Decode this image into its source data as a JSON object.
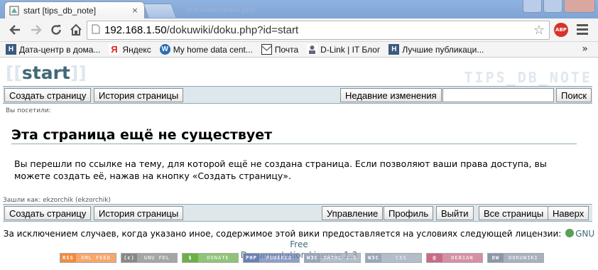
{
  "browser": {
    "tab_title": "start [tips_db_note]",
    "tab_close": "×",
    "ghost_tab_title": "dokuwiki/doku.php",
    "url_host": "192.168.1.50",
    "url_path": "/dokuwiki/doku.php?id=start",
    "abp_label": "ABP",
    "bookmarks": [
      {
        "label": "Дата-центр в дома...",
        "icon": "habr-icon"
      },
      {
        "label": "Яндекс",
        "icon": "yandex-icon"
      },
      {
        "label": "My home data cent...",
        "icon": "wordpress-icon"
      },
      {
        "label": "Почта",
        "icon": "mail-icon"
      },
      {
        "label": "D-Link | IT Блог",
        "icon": "dlink-icon"
      },
      {
        "label": "Лучшие публикаци...",
        "icon": "habr-icon"
      }
    ],
    "bookmarks_more": "»"
  },
  "wiki": {
    "page_name": "start",
    "page_name_open": "[[",
    "page_name_close": "]]",
    "wiki_title": "TIPS_DB_NOTE",
    "top_bar": {
      "create_page": "Создать страницу",
      "page_history": "История страницы",
      "recent_changes": "Недавние изменения",
      "search_value": "",
      "search_button": "Поиск"
    },
    "breadcrumbs": "Вы посетили:",
    "heading": "Эта страница ещё не существует",
    "body_line1": "Вы перешли по ссылке на тему, для которой ещё не создана страница. Если позволяют ваши права доступа, вы",
    "body_line2": "можете создать её, нажав на кнопку «Создать страницу».",
    "logged_in": "Зашли как: ekzorchik (ekzorchik)",
    "bottom_bar": {
      "create_page": "Создать страницу",
      "page_history": "История страницы",
      "admin": "Управление",
      "profile": "Профиль",
      "logout": "Выйти",
      "all_pages": "Все страницы",
      "top": "Наверх"
    },
    "license_text": "За исключением случаев, когда указано иное, содержимое этой вики предоставляется на условиях следующей лицензии:",
    "license_link_1": "GNU Free",
    "license_link_2": "Documentation License 1.3",
    "badges": [
      {
        "left": "RSS",
        "right": "XML FEED",
        "color": "#f28a3b"
      },
      {
        "left": "(c)",
        "right": "GNU FDL",
        "color": "#888888"
      },
      {
        "left": "$",
        "right": "DONATE",
        "color": "#6cb04a"
      },
      {
        "left": "PHP",
        "right": "POWERED",
        "color": "#6a7fb3"
      },
      {
        "left": "W3C",
        "right": "XHTML 1.0",
        "color": "#9aa6b8"
      },
      {
        "left": "W3C",
        "right": "CSS",
        "color": "#9aa6b8"
      },
      {
        "left": "@",
        "right": "DEBIAN",
        "color": "#c86b86"
      },
      {
        "left": "DW",
        "right": "DOKUWIKI",
        "color": "#8c96a8"
      }
    ]
  }
}
